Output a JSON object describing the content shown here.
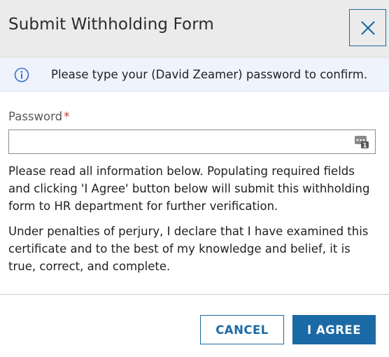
{
  "dialog": {
    "title": "Submit Withholding Form",
    "close_icon": "close-icon"
  },
  "info": {
    "icon": "info-circle-icon",
    "message": "Please type your (David Zeamer) password to confirm."
  },
  "form": {
    "password_label": "Password",
    "required_marker": "*",
    "password_value": "",
    "password_manager_icon": "password-manager-icon",
    "password_manager_badge": "1"
  },
  "body": {
    "paragraph_1": "Please read all information below. Populating required fields and clicking 'I Agree' button below will submit this withholding form to HR department for further verification.",
    "paragraph_2": "Under penalties of perjury, I declare that I have examined this certificate and to the best of my knowledge and belief, it is true, correct, and complete."
  },
  "actions": {
    "cancel_label": "CANCEL",
    "agree_label": "I AGREE"
  },
  "colors": {
    "accent": "#1b6aa6",
    "header_bg": "#ebebeb",
    "info_bg": "#eef3fc",
    "required": "#c0392b"
  }
}
